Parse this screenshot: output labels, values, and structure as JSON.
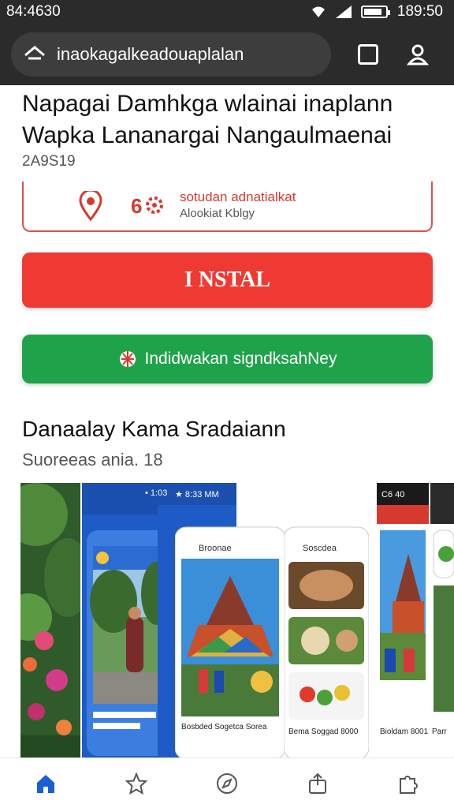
{
  "status": {
    "time_left": "84:4630",
    "time_right": "189:50",
    "battery_level": 0.85
  },
  "browser": {
    "url": "inaokagalkeadouaplalan"
  },
  "app": {
    "title": "Napagai Damhkga wlainai inaplann Wapka Lananargai Nangaulmaenai",
    "meta": "2A9S19"
  },
  "info_card": {
    "line1": "sotudan adnatialkat",
    "line2": "Alookiat Kblgy",
    "pin_icon": "location-pin-icon",
    "gear_icon": "gear-icon"
  },
  "buttons": {
    "install_label": "I NSTAL",
    "secondary_label": "Indidwakan signdksahNey",
    "secondary_icon": "globe-icon"
  },
  "section": {
    "title": "Danaalay Kama Sradaiann",
    "subtitle": "Suoreeas ania. 18"
  },
  "screenshots": [
    {
      "status_time": "",
      "caption": ""
    },
    {
      "status_time": "★ 8:33 MM",
      "left_status": "• 1:03",
      "header": "Broonae",
      "caption": "Bosbded Sogetca Sorea"
    },
    {
      "header": "Soscdea",
      "caption": "Bema Soggad 8000"
    },
    {
      "status_time": "C6 40",
      "caption": "Bioldam 8001"
    },
    {
      "caption": "Parr"
    }
  ],
  "colors": {
    "install": "#ee3a33",
    "secondary": "#1fa34a",
    "chrome": "#2b2b2b",
    "nav_active": "#1a5fd4"
  },
  "bottom_nav": [
    {
      "icon": "home-icon",
      "active": true
    },
    {
      "icon": "star-icon",
      "active": false
    },
    {
      "icon": "compass-icon",
      "active": false
    },
    {
      "icon": "share-icon",
      "active": false
    },
    {
      "icon": "puzzle-icon",
      "active": false
    }
  ]
}
